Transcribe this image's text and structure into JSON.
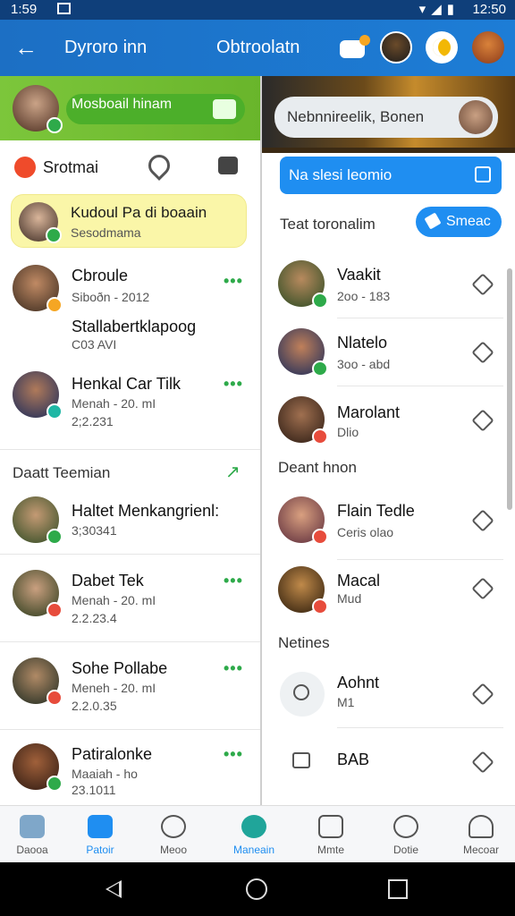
{
  "status_bar": {
    "time_left": "1:59",
    "time_right": "12:50",
    "icons": [
      "wifi-icon",
      "signal-icon",
      "battery-icon"
    ]
  },
  "app_bar": {
    "title_left": "Dyroro inn",
    "title_right": "Obtroolatn"
  },
  "left": {
    "header_pill": "Mosboail hinam",
    "search_label": "Srotmai",
    "highlight": {
      "name": "Kudoul Pa di boaain",
      "sub": "Sesodmama"
    },
    "rows": [
      {
        "name": "Cbroule",
        "sub": "Siboðn - 2012",
        "sub2": "",
        "more": "•••"
      },
      {
        "name": "Stallabertklapoog",
        "sub": "C03 AVI",
        "sub2": "",
        "more": ""
      },
      {
        "name": "Henkal Car Tilk",
        "sub": "Menah - 20. mI",
        "sub2": "2;2.231",
        "more": "•••"
      }
    ],
    "section_title": "Daatt Teemian",
    "rows2": [
      {
        "name": "Haltet Menkangrienl:",
        "sub": "3;30341",
        "sub2": "",
        "more": ""
      },
      {
        "name": "Dabet Tek",
        "sub": "Menah - 20. mI",
        "sub2": "2.2.23.4",
        "more": "•••"
      },
      {
        "name": "Sohe Pollabe",
        "sub": "Meneh - 20. mI",
        "sub2": "2.2.0.35",
        "more": "•••"
      },
      {
        "name": "Patiralonke",
        "sub": "Maaiah - ho",
        "sub2": "23.1011",
        "more": "•••"
      }
    ]
  },
  "right": {
    "banner_text": "Nebnnireelik, Bonen",
    "blue_button": "Na slesi leomio",
    "section_label": "Teat toronalim",
    "pill_button": "Smeac",
    "rows": [
      {
        "name": "Vaakit",
        "sub": "2oo - 183"
      },
      {
        "name": "Nlatelo",
        "sub": "3oo - abd"
      },
      {
        "name": "Marolant",
        "sub": "Dlio"
      }
    ],
    "section2": "Deant hnon",
    "rows2": [
      {
        "name": "Flain Tedle",
        "sub": "Ceris olao"
      },
      {
        "name": "Macal",
        "sub": "Mud"
      }
    ],
    "section3": "Netines",
    "rows3": [
      {
        "name": "Aohnt",
        "sub": "M1"
      },
      {
        "name": "BAB",
        "sub": ""
      }
    ]
  },
  "bottom_nav": [
    {
      "label": "Daooa",
      "icon": "home-icon"
    },
    {
      "label": "Patoir",
      "icon": "house-icon"
    },
    {
      "label": "Meoo",
      "icon": "chat-icon"
    },
    {
      "label": "Maneain",
      "icon": "bell-icon"
    },
    {
      "label": "Mmte",
      "icon": "list-icon"
    },
    {
      "label": "Dotie",
      "icon": "star-icon"
    },
    {
      "label": "Mecoar",
      "icon": "profile-icon"
    }
  ],
  "colors": {
    "appbar": "#1c6fc4",
    "green": "#69b52b",
    "blue": "#1f8ef1"
  }
}
